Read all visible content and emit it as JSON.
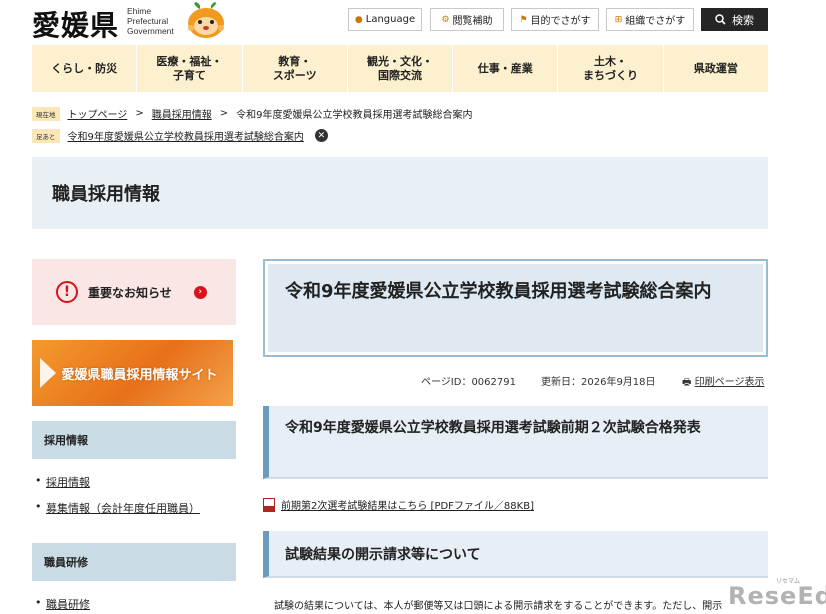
{
  "header": {
    "logo_kanji": "愛媛県",
    "logo_en_1": "Ehime",
    "logo_en_2": "Prefectural",
    "logo_en_3": "Government",
    "buttons": {
      "language": "Language",
      "accessibility": "閲覧補助",
      "purpose": "目的でさがす",
      "organization": "組織でさがす",
      "search": "検索"
    }
  },
  "gnav": [
    {
      "label": "くらし・防災"
    },
    {
      "label": "医療・福祉・\n子育て"
    },
    {
      "label": "教育・\nスポーツ"
    },
    {
      "label": "観光・文化・\n国際交流"
    },
    {
      "label": "仕事・産業"
    },
    {
      "label": "土木・\nまちづくり"
    },
    {
      "label": "県政運営"
    }
  ],
  "breadcrumb": {
    "current_badge": "現在地",
    "top": "トップページ",
    "sep": ">",
    "category": "職員採用情報",
    "page": "令和9年度愛媛県公立学校教員採用選考試験総合案内",
    "history_badge": "足あと",
    "history_item": "令和9年度愛媛県公立学校教員採用選考試験総合案内"
  },
  "section_title": "職員採用情報",
  "sidebar": {
    "notice": "重要なお知らせ",
    "banner": "愛媛県職員採用情報サイト",
    "groups": [
      {
        "heading": "採用情報",
        "links": [
          "採用情報",
          "募集情報（会計年度任用職員）"
        ]
      },
      {
        "heading": "職員研修",
        "links": [
          "職員研修"
        ]
      }
    ]
  },
  "main": {
    "title": "令和9年度愛媛県公立学校教員採用選考試験総合案内",
    "page_id": "ページID：0062791",
    "updated": "更新日：2026年9月18日",
    "print": "印刷ページ表示",
    "h2_first": "令和9年度愛媛県公立学校教員採用選考試験前期２次試験合格発表",
    "pdf_link": "前期第2次選考試験結果はこちら [PDFファイル／88KB]",
    "h2_second": "試験結果の開示請求等について",
    "body": "試験の結果については、本人が郵便等又は口頭による開示請求をすることができます。ただし、開示"
  },
  "watermark": {
    "text": "ReseEd",
    "small": "リセマム"
  },
  "colors": {
    "nav_bg": "#fdf0cf",
    "accent_red": "#d6131b",
    "banner_orange": "#e8701a",
    "side_head": "#c9dbe4",
    "title_bg": "#dee9f2"
  }
}
